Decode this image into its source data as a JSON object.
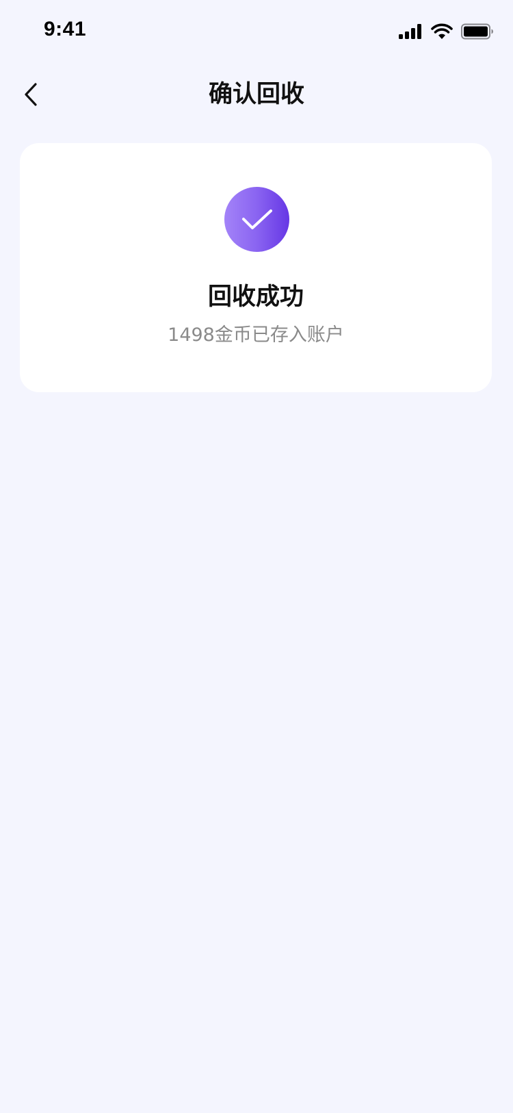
{
  "status_bar": {
    "time": "9:41",
    "icons": [
      "signal-icon",
      "wifi-icon",
      "battery-icon"
    ]
  },
  "nav": {
    "back_icon": "chevron-left-icon",
    "title": "确认回收"
  },
  "result": {
    "icon": "check-icon",
    "title": "回收成功",
    "description": "1498金币已存入账户"
  },
  "colors": {
    "background": "#f4f5fe",
    "card": "#ffffff",
    "accent_start": "#a383f8",
    "accent_end": "#6637e5",
    "text_primary": "#111111",
    "text_secondary": "#8a8a8a"
  }
}
